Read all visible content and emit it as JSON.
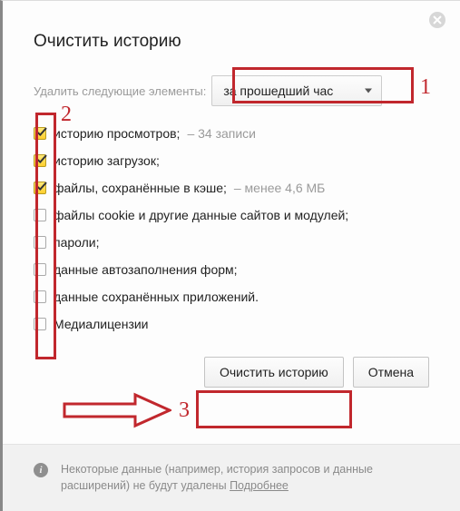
{
  "title": "Очистить историю",
  "range": {
    "label": "Удалить следующие элементы:",
    "selected": "за прошедший час"
  },
  "options": [
    {
      "label": "историю просмотров;",
      "sub": "–   34 записи",
      "checked": true
    },
    {
      "label": "историю загрузок;",
      "sub": "",
      "checked": true
    },
    {
      "label": "файлы, сохранённые в кэше;",
      "sub": "–   менее 4,6 МБ",
      "checked": true
    },
    {
      "label": "файлы cookie и другие данные сайтов и модулей;",
      "sub": "",
      "checked": false
    },
    {
      "label": "пароли;",
      "sub": "",
      "checked": false
    },
    {
      "label": "данные автозаполнения форм;",
      "sub": "",
      "checked": false
    },
    {
      "label": "данные сохранённых приложений.",
      "sub": "",
      "checked": false
    },
    {
      "label": "Медиалицензии",
      "sub": "",
      "checked": false
    }
  ],
  "actions": {
    "primary": "Очистить историю",
    "cancel": "Отмена"
  },
  "footer": {
    "text": "Некоторые данные (например, история запросов и данные расширений) не будут удалены ",
    "link": "Подробнее"
  },
  "annotations": {
    "n1": "1",
    "n2": "2",
    "n3": "3"
  }
}
